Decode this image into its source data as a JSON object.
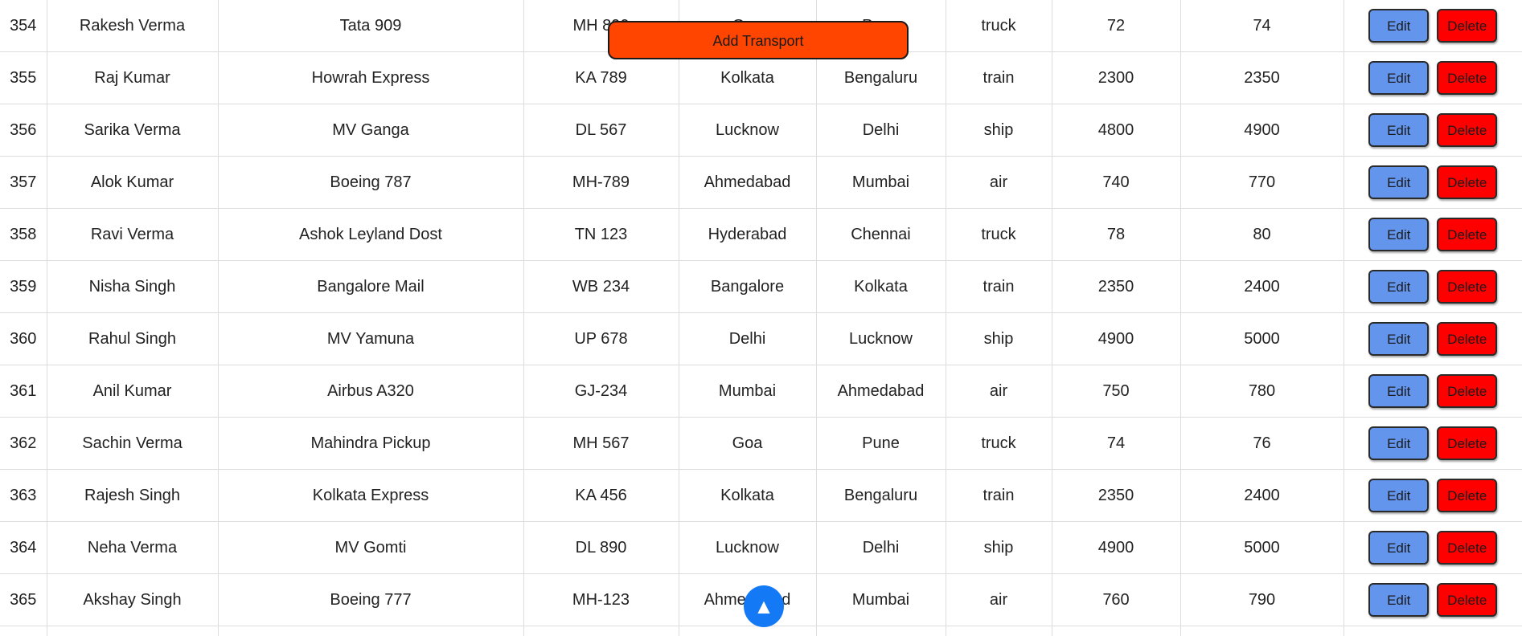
{
  "add_button_label": "Add Transport",
  "scroll_top_glyph": "▲",
  "actions": {
    "edit_label": "Edit",
    "delete_label": "Delete"
  },
  "colors": {
    "edit": "#6495ED",
    "delete": "#ff0000",
    "add": "#ff4500",
    "scroll_top": "#1479f5"
  },
  "rows": [
    {
      "id": "354",
      "name": "Rakesh Verma",
      "vehicle": "Tata 909",
      "reg": "MH 890",
      "from": "Goa",
      "to": "Pune",
      "mode": "truck",
      "v1": "72",
      "v2": "74"
    },
    {
      "id": "355",
      "name": "Raj Kumar",
      "vehicle": "Howrah Express",
      "reg": "KA 789",
      "from": "Kolkata",
      "to": "Bengaluru",
      "mode": "train",
      "v1": "2300",
      "v2": "2350"
    },
    {
      "id": "356",
      "name": "Sarika Verma",
      "vehicle": "MV Ganga",
      "reg": "DL 567",
      "from": "Lucknow",
      "to": "Delhi",
      "mode": "ship",
      "v1": "4800",
      "v2": "4900"
    },
    {
      "id": "357",
      "name": "Alok Kumar",
      "vehicle": "Boeing 787",
      "reg": "MH-789",
      "from": "Ahmedabad",
      "to": "Mumbai",
      "mode": "air",
      "v1": "740",
      "v2": "770"
    },
    {
      "id": "358",
      "name": "Ravi Verma",
      "vehicle": "Ashok Leyland Dost",
      "reg": "TN 123",
      "from": "Hyderabad",
      "to": "Chennai",
      "mode": "truck",
      "v1": "78",
      "v2": "80"
    },
    {
      "id": "359",
      "name": "Nisha Singh",
      "vehicle": "Bangalore Mail",
      "reg": "WB 234",
      "from": "Bangalore",
      "to": "Kolkata",
      "mode": "train",
      "v1": "2350",
      "v2": "2400"
    },
    {
      "id": "360",
      "name": "Rahul Singh",
      "vehicle": "MV Yamuna",
      "reg": "UP 678",
      "from": "Delhi",
      "to": "Lucknow",
      "mode": "ship",
      "v1": "4900",
      "v2": "5000"
    },
    {
      "id": "361",
      "name": "Anil Kumar",
      "vehicle": "Airbus A320",
      "reg": "GJ-234",
      "from": "Mumbai",
      "to": "Ahmedabad",
      "mode": "air",
      "v1": "750",
      "v2": "780"
    },
    {
      "id": "362",
      "name": "Sachin Verma",
      "vehicle": "Mahindra Pickup",
      "reg": "MH 567",
      "from": "Goa",
      "to": "Pune",
      "mode": "truck",
      "v1": "74",
      "v2": "76"
    },
    {
      "id": "363",
      "name": "Rajesh Singh",
      "vehicle": "Kolkata Express",
      "reg": "KA 456",
      "from": "Kolkata",
      "to": "Bengaluru",
      "mode": "train",
      "v1": "2350",
      "v2": "2400"
    },
    {
      "id": "364",
      "name": "Neha Verma",
      "vehicle": "MV Gomti",
      "reg": "DL 890",
      "from": "Lucknow",
      "to": "Delhi",
      "mode": "ship",
      "v1": "4900",
      "v2": "5000"
    },
    {
      "id": "365",
      "name": "Akshay Singh",
      "vehicle": "Boeing 777",
      "reg": "MH-123",
      "from": "Ahmedabad",
      "to": "Mumbai",
      "mode": "air",
      "v1": "760",
      "v2": "790"
    }
  ]
}
